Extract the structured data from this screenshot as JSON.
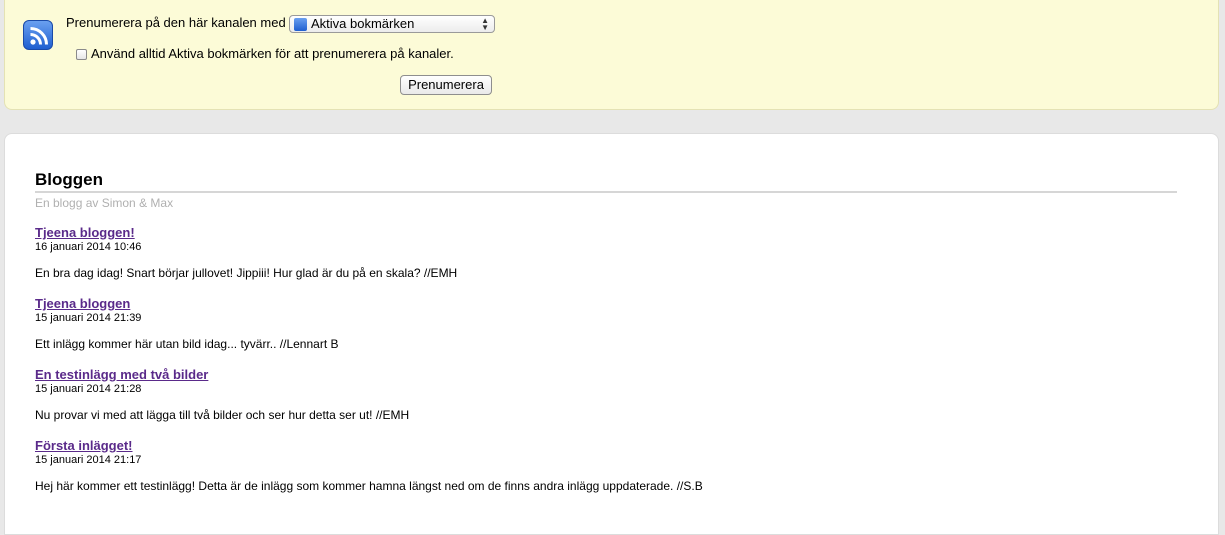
{
  "subscribe": {
    "label": "Prenumerera på den här kanalen med",
    "reader_selected": "Aktiva bokmärken",
    "always_use_label": "Använd alltid Aktiva bokmärken för att prenumerera på kanaler.",
    "always_use_checked": false,
    "button_label": "Prenumerera"
  },
  "feed": {
    "title": "Bloggen",
    "subtitle": "En blogg av Simon & Max"
  },
  "entries": [
    {
      "title": "Tjeena bloggen!",
      "date": "16 januari 2014 10:46",
      "body": "En bra dag idag! Snart börjar jullovet! Jippiii! Hur glad är du på en skala? //EMH"
    },
    {
      "title": "Tjeena bloggen",
      "date": "15 januari 2014 21:39",
      "body": "Ett inlägg kommer här utan bild idag... tyvärr.. //Lennart B"
    },
    {
      "title": "En testinlägg med två bilder",
      "date": "15 januari 2014 21:28",
      "body": "Nu provar vi med att lägga till två bilder och ser hur detta ser ut! //EMH"
    },
    {
      "title": "Första inlägget!",
      "date": "15 januari 2014 21:17",
      "body": "Hej här kommer ett testinlägg! Detta är de inlägg som kommer hamna längst ned om de finns andra inlägg uppdaterade. //S.B"
    }
  ],
  "icons": {
    "feed_icon": "rss-feed-icon",
    "select_icon": "rss-feed-icon",
    "select_arrows": "updown-arrows-icon"
  },
  "colors": {
    "subscribe_bg": "#fcfbd7",
    "link": "#5a2a8a",
    "subtitle": "#b0b0b0"
  }
}
